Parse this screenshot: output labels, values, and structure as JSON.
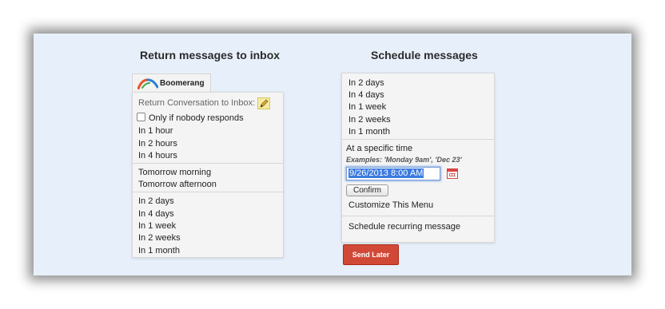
{
  "headings": {
    "left": "Return messages to inbox",
    "right": "Schedule messages"
  },
  "boomerang_tab": {
    "label": "Boomerang"
  },
  "return_menu": {
    "title": "Return Conversation to Inbox:",
    "checkbox_label": "Only if nobody responds",
    "checkbox_checked": false,
    "group1": [
      "In 1 hour",
      "In 2 hours",
      "In 4 hours"
    ],
    "group2": [
      "Tomorrow morning",
      "Tomorrow afternoon"
    ],
    "group3": [
      "In 2 days",
      "In 4 days",
      "In 1 week",
      "In 2 weeks",
      "In 1 month"
    ]
  },
  "schedule_menu": {
    "options": [
      "In 2 days",
      "In 4 days",
      "In 1 week",
      "In 2 weeks",
      "In 1 month"
    ],
    "specific_label": "At a specific time",
    "examples": "Examples: 'Monday 9am', 'Dec 23'",
    "date_value": "9/26/2013 8:00 AM",
    "confirm_label": "Confirm",
    "customize_label": "Customize This Menu",
    "recurring_label": "Schedule recurring message"
  },
  "send_later": {
    "label": "Send Later"
  },
  "colors": {
    "frame_bg": "#e7f0fa",
    "send_later": "#d14836",
    "selection": "#3b7be0"
  },
  "icons": [
    "boomerang-logo-icon",
    "edit-pencil-icon",
    "calendar-icon"
  ]
}
